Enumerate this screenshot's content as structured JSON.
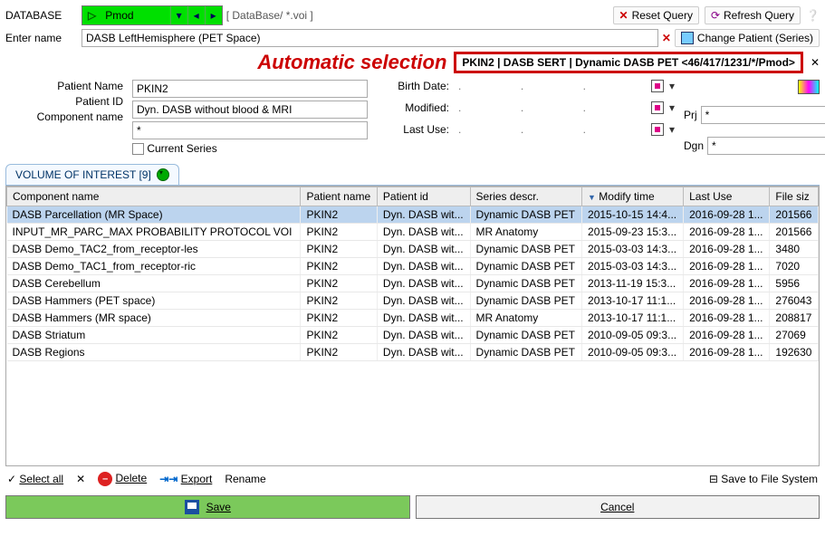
{
  "header": {
    "database_label": "DATABASE",
    "db_selected": "Pmod",
    "path_hint": "[ DataBase/ *.voi ]",
    "reset_query": "Reset Query",
    "refresh_query": "Refresh Query"
  },
  "entry": {
    "enter_name_label": "Enter name",
    "enter_name_value": "DASB LeftHemisphere (PET Space)",
    "change_patient": "Change Patient (Series)"
  },
  "annotation": "Automatic selection",
  "redbox_text": "PKIN2 | DASB SERT | Dynamic DASB PET <46/417/1231/*/Pmod>",
  "filters": {
    "patient_name_label": "Patient Name",
    "patient_name_value": "PKIN2",
    "patient_id_label": "Patient ID",
    "patient_id_value": "Dyn. DASB without blood & MRI",
    "component_name_label": "Component name",
    "component_name_value": "*",
    "current_series_label": "Current Series",
    "birth_date_label": "Birth Date:",
    "modified_label": "Modified:",
    "last_use_label": "Last Use:",
    "prj_label": "Prj",
    "prj_value": "*",
    "dgn_label": "Dgn",
    "dgn_value": "*"
  },
  "tab": {
    "label": "VOLUME OF INTEREST [9]"
  },
  "table": {
    "headers": {
      "component": "Component name",
      "patient_name": "Patient name",
      "patient_id": "Patient id",
      "series": "Series descr.",
      "modify": "Modify time",
      "lastuse": "Last Use",
      "filesize": "File siz"
    },
    "rows": [
      {
        "c": "DASB Parcellation (MR Space)",
        "pn": "PKIN2",
        "pid": "Dyn. DASB wit...",
        "s": "Dynamic DASB PET",
        "m": "2015-10-15 14:4...",
        "l": "2016-09-28 1...",
        "f": "201566"
      },
      {
        "c": "INPUT_MR_PARC_MAX PROBABILITY PROTOCOL VOI",
        "pn": "PKIN2",
        "pid": "Dyn. DASB wit...",
        "s": "MR Anatomy",
        "m": "2015-09-23 15:3...",
        "l": "2016-09-28 1...",
        "f": "201566"
      },
      {
        "c": "DASB Demo_TAC2_from_receptor-les",
        "pn": "PKIN2",
        "pid": "Dyn. DASB wit...",
        "s": "Dynamic DASB PET",
        "m": "2015-03-03 14:3...",
        "l": "2016-09-28 1...",
        "f": "3480"
      },
      {
        "c": "DASB Demo_TAC1_from_receptor-ric",
        "pn": "PKIN2",
        "pid": "Dyn. DASB wit...",
        "s": "Dynamic DASB PET",
        "m": "2015-03-03 14:3...",
        "l": "2016-09-28 1...",
        "f": "7020"
      },
      {
        "c": "DASB Cerebellum",
        "pn": "PKIN2",
        "pid": "Dyn. DASB wit...",
        "s": "Dynamic DASB PET",
        "m": "2013-11-19 15:3...",
        "l": "2016-09-28 1...",
        "f": "5956"
      },
      {
        "c": "DASB Hammers (PET space)",
        "pn": "PKIN2",
        "pid": "Dyn. DASB wit...",
        "s": "Dynamic DASB PET",
        "m": "2013-10-17 11:1...",
        "l": "2016-09-28 1...",
        "f": "276043"
      },
      {
        "c": "DASB Hammers (MR space)",
        "pn": "PKIN2",
        "pid": "Dyn. DASB wit...",
        "s": "MR Anatomy",
        "m": "2013-10-17 11:1...",
        "l": "2016-09-28 1...",
        "f": "208817"
      },
      {
        "c": "DASB Striatum",
        "pn": "PKIN2",
        "pid": "Dyn. DASB wit...",
        "s": "Dynamic DASB PET",
        "m": "2010-09-05 09:3...",
        "l": "2016-09-28 1...",
        "f": "27069"
      },
      {
        "c": "DASB Regions",
        "pn": "PKIN2",
        "pid": "Dyn. DASB wit...",
        "s": "Dynamic DASB PET",
        "m": "2010-09-05 09:3...",
        "l": "2016-09-28 1...",
        "f": "192630"
      }
    ]
  },
  "footer": {
    "select_all": "Select all",
    "delete": "Delete",
    "export": "Export",
    "rename": "Rename",
    "save_fs": "Save to File System",
    "save": "Save",
    "cancel": "Cancel"
  }
}
